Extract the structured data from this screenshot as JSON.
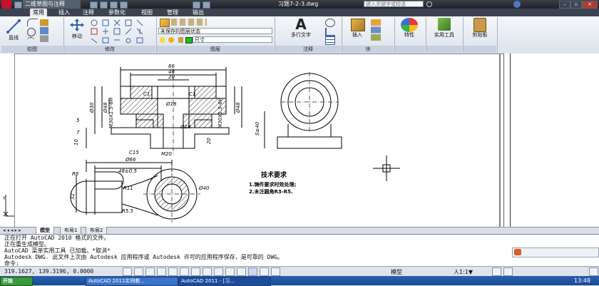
{
  "titlebar": {
    "workspace": "二维草图与注释",
    "file_title": "习题7-2-3.dwg",
    "search_placeholder": "键入关键字或短语",
    "min": "–",
    "max": "▫",
    "close": "×"
  },
  "ribbon_tabs": [
    "常用",
    "插入",
    "注释",
    "参数化",
    "视图",
    "管理",
    "输出"
  ],
  "ribbon": {
    "line_label": "直线",
    "move_label": "移动",
    "layer_state": "未保存的图层状态",
    "layer_name": "尺寸",
    "mtext_label": "多行文字",
    "insert_label": "插入",
    "properties_label": "特性",
    "utilities_label": "实用工具",
    "clipboard_label": "剪贴板",
    "panels": {
      "draw": "绘图",
      "modify": "修改",
      "layers": "图层",
      "annotation": "注释",
      "block": "块"
    }
  },
  "drawing": {
    "dims": {
      "d66_top": "66",
      "d48_top": "48",
      "d20_top": "20",
      "c1_left": "C1",
      "c1_right": "C1",
      "phi18": "Ø18",
      "phi18b": "Ø18",
      "m20": "M20",
      "c15": "C15",
      "m30": "M30X1.5-6H",
      "phi48": "Ø48",
      "phi30": "Ø30",
      "m30b": "M30X1.5-6H",
      "phi48b": "Ø48",
      "d10": "10",
      "d20v": "20",
      "dim7": "7",
      "dim5": "5",
      "phi66": "Ø66",
      "d48plus": "48±0.5",
      "r6": "R6",
      "r11": "R11",
      "r5_5": "R5.5",
      "phi40": "Ø40",
      "d32": "32",
      "s40": "S≥40"
    },
    "notes_title": "技术要求",
    "notes": [
      "1.铸件要求时效处理;",
      "2.未注圆角R3-R5."
    ]
  },
  "layout_tabs": [
    "模型",
    "布局1",
    "布局2"
  ],
  "command_lines": [
    "正在打开 AutoCAD 2010 格式的文件。",
    "正在重生成模型。",
    "AutoCAD 菜单实用工具 已加载。*取消*",
    "Autodesk DWG.   此文件上次由 Autodesk 应用程序或 Autodesk 许可的应用程序保存，是可靠的 DWG。",
    "命令:"
  ],
  "status": {
    "coords": "319.1627, 139.3196, 0.0000",
    "model": "模型",
    "scale": "人1:1▼"
  },
  "taskbar": {
    "start": "开始",
    "task1": "AutoCAD 2011实例教...",
    "task2": "AutoCAD 2011 - [习...",
    "clock": "13:48"
  },
  "colors": {
    "ribbon_bg": "#e8ecf2",
    "titlebar": "#2a2f38",
    "layer_green": "#19c219",
    "logo_red": "#c8102e"
  }
}
